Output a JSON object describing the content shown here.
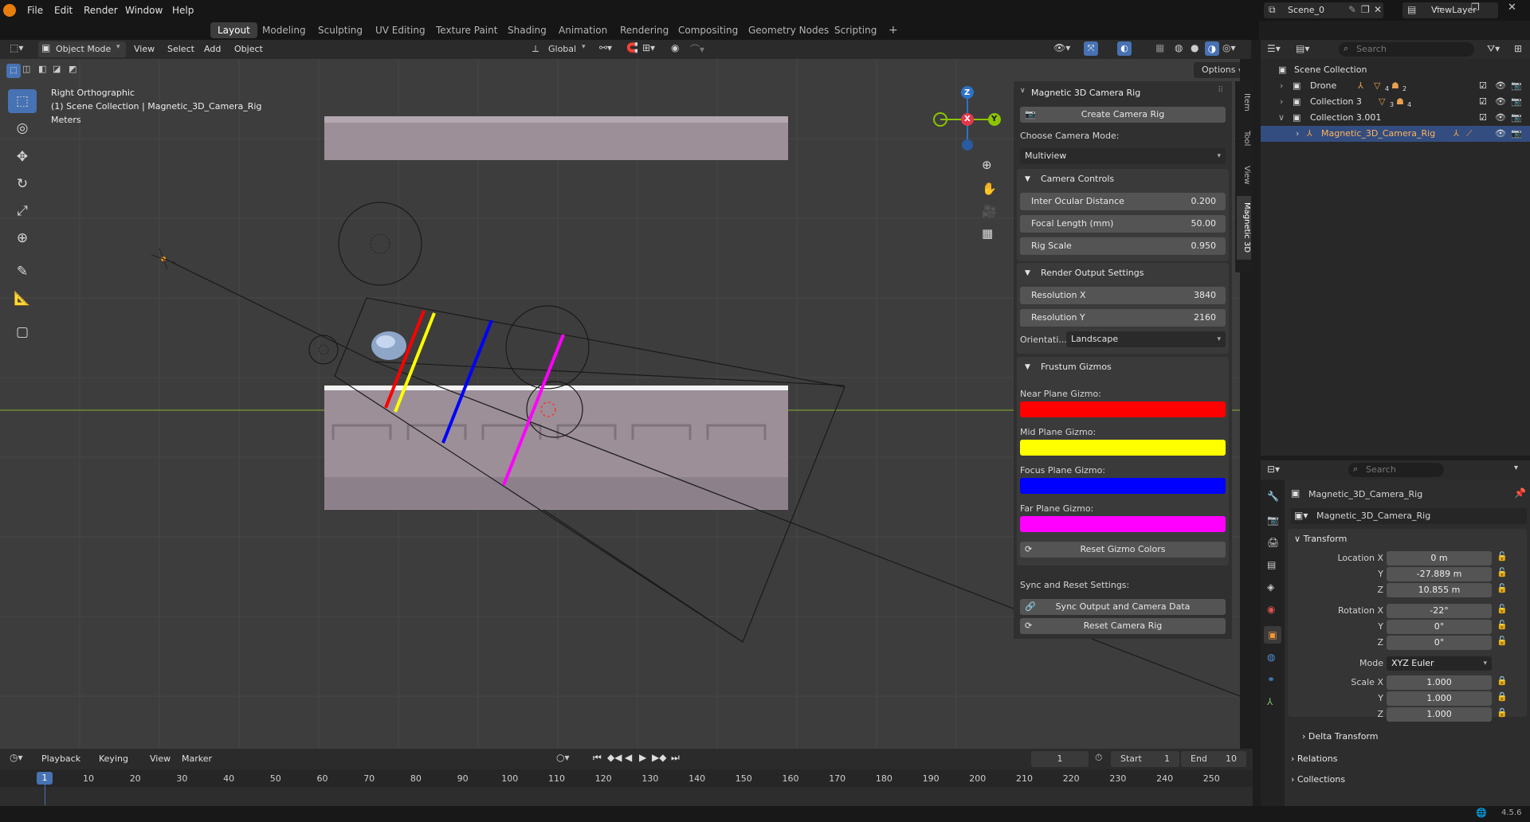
{
  "topbar": {
    "menus": [
      "File",
      "Edit",
      "Render",
      "Window",
      "Help"
    ],
    "workspaces": [
      "Layout",
      "Modeling",
      "Sculpting",
      "UV Editing",
      "Texture Paint",
      "Shading",
      "Animation",
      "Rendering",
      "Compositing",
      "Geometry Nodes",
      "Scripting"
    ],
    "add_tab": "+",
    "scene_name": "Scene_0",
    "view_layer": "ViewLayer"
  },
  "viewport_header": {
    "mode": "Object Mode",
    "menus": [
      "View",
      "Select",
      "Add",
      "Object"
    ],
    "transform_orientation": "Global",
    "options_label": "Options"
  },
  "viewport": {
    "view_name": "Right Orthographic",
    "collection_path": "(1) Scene Collection | Magnetic_3D_Camera_Rig",
    "units": "Meters",
    "axis_labels": {
      "x": "X",
      "y": "Y",
      "z": "Z"
    },
    "gizmo_colors": {
      "near": "#ff0000",
      "mid": "#ffff00",
      "focus": "#0000ff",
      "far": "#ff00ff"
    }
  },
  "npanel": {
    "title": "Magnetic 3D Camera Rig",
    "create_button": "Create Camera Rig",
    "choose_mode_label": "Choose Camera Mode:",
    "camera_mode": "Multiview",
    "camera_controls": {
      "title": "Camera Controls",
      "fields": [
        {
          "label": "Inter Ocular Distance",
          "value": "0.200"
        },
        {
          "label": "Focal Length (mm)",
          "value": "50.00"
        },
        {
          "label": "Rig Scale",
          "value": "0.950"
        }
      ]
    },
    "render_output": {
      "title": "Render Output Settings",
      "fields": [
        {
          "label": "Resolution X",
          "value": "3840"
        },
        {
          "label": "Resolution Y",
          "value": "2160"
        }
      ],
      "orientation_label": "Orientati...",
      "orientation_value": "Landscape"
    },
    "frustum": {
      "title": "Frustum Gizmos",
      "items": [
        {
          "label": "Near Plane Gizmo:",
          "color": "#ff0000"
        },
        {
          "label": "Mid Plane Gizmo:",
          "color": "#ffff00"
        },
        {
          "label": "Focus Plane Gizmo:",
          "color": "#0000ff"
        },
        {
          "label": "Far Plane Gizmo:",
          "color": "#ff00ff"
        }
      ],
      "reset_colors": "Reset Gizmo Colors"
    },
    "sync_label": "Sync and Reset Settings:",
    "sync_button": "Sync Output and Camera Data",
    "reset_button": "Reset Camera Rig",
    "tabs": [
      "Item",
      "Tool",
      "View",
      "Magnetic 3D"
    ]
  },
  "outliner": {
    "search_placeholder": "Search",
    "root": "Scene Collection",
    "items": [
      {
        "name": "Drone",
        "badge1": "4",
        "badge2": "2"
      },
      {
        "name": "Collection 3",
        "badge1": "3",
        "badge2": "4"
      },
      {
        "name": "Collection 3.001",
        "badge1": "",
        "badge2": ""
      },
      {
        "name": "Magnetic_3D_Camera_Rig",
        "badge1": "",
        "badge2": ""
      }
    ]
  },
  "properties": {
    "search_placeholder": "Search",
    "object_name": "Magnetic_3D_Camera_Rig",
    "object_field": "Magnetic_3D_Camera_Rig",
    "transform_title": "Transform",
    "location": {
      "label": "Location X",
      "x": "0 m",
      "y": "-27.889 m",
      "z": "10.855 m"
    },
    "rotation": {
      "label": "Rotation X",
      "x": "-22°",
      "y": "0°",
      "z": "0°"
    },
    "mode_label": "Mode",
    "mode_value": "XYZ Euler",
    "scale": {
      "label": "Scale X",
      "x": "1.000",
      "y": "1.000",
      "z": "1.000"
    },
    "axis_y": "Y",
    "axis_z": "Z",
    "delta": "Delta Transform",
    "relations": "Relations",
    "collections": "Collections"
  },
  "timeline": {
    "menus": [
      "Playback",
      "Keying",
      "View",
      "Marker"
    ],
    "current_frame": "1",
    "start_label": "Start",
    "start_value": "1",
    "end_label": "End",
    "end_value": "10",
    "ticks": [
      "1",
      "10",
      "20",
      "30",
      "40",
      "50",
      "60",
      "70",
      "80",
      "90",
      "100",
      "110",
      "120",
      "130",
      "140",
      "150",
      "160",
      "170",
      "180",
      "190",
      "200",
      "210",
      "220",
      "230",
      "240",
      "250"
    ]
  },
  "statusbar": {
    "version": "4.5.6"
  }
}
